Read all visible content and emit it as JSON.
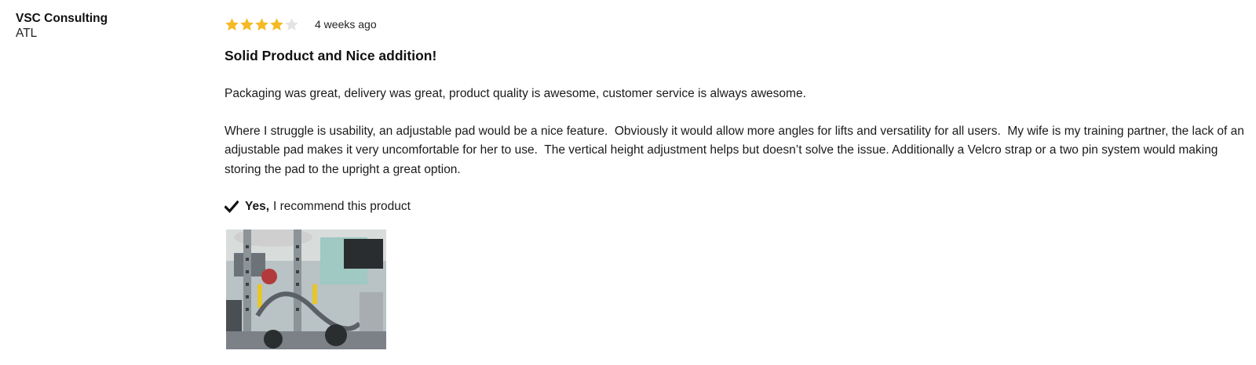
{
  "author": {
    "name": "VSC Consulting",
    "location": "ATL"
  },
  "review": {
    "rating": 4,
    "rating_max": 5,
    "star_color_filled": "#f5b921",
    "star_color_empty": "#e3e3e3",
    "timestamp": "4 weeks ago",
    "title": "Solid Product and Nice addition!",
    "paragraphs": [
      "Packaging was great, delivery was great, product quality is awesome, customer service is always awesome.",
      "Where I struggle is usability, an adjustable pad would be a nice feature.  Obviously it would allow more angles for lifts and versatility for all users.  My wife is my training partner, the lack of an adjustable pad makes it very uncomfortable for her to use.  The vertical height adjustment helps but doesn’t solve the issue. Additionally a Velcro strap or a two pin system would making storing the pad to the upright a great option."
    ],
    "recommend": {
      "icon": "checkmark-icon",
      "yes_label": "Yes,",
      "text": "I recommend this product"
    },
    "photo": {
      "icon": "review-photo-thumbnail"
    }
  }
}
